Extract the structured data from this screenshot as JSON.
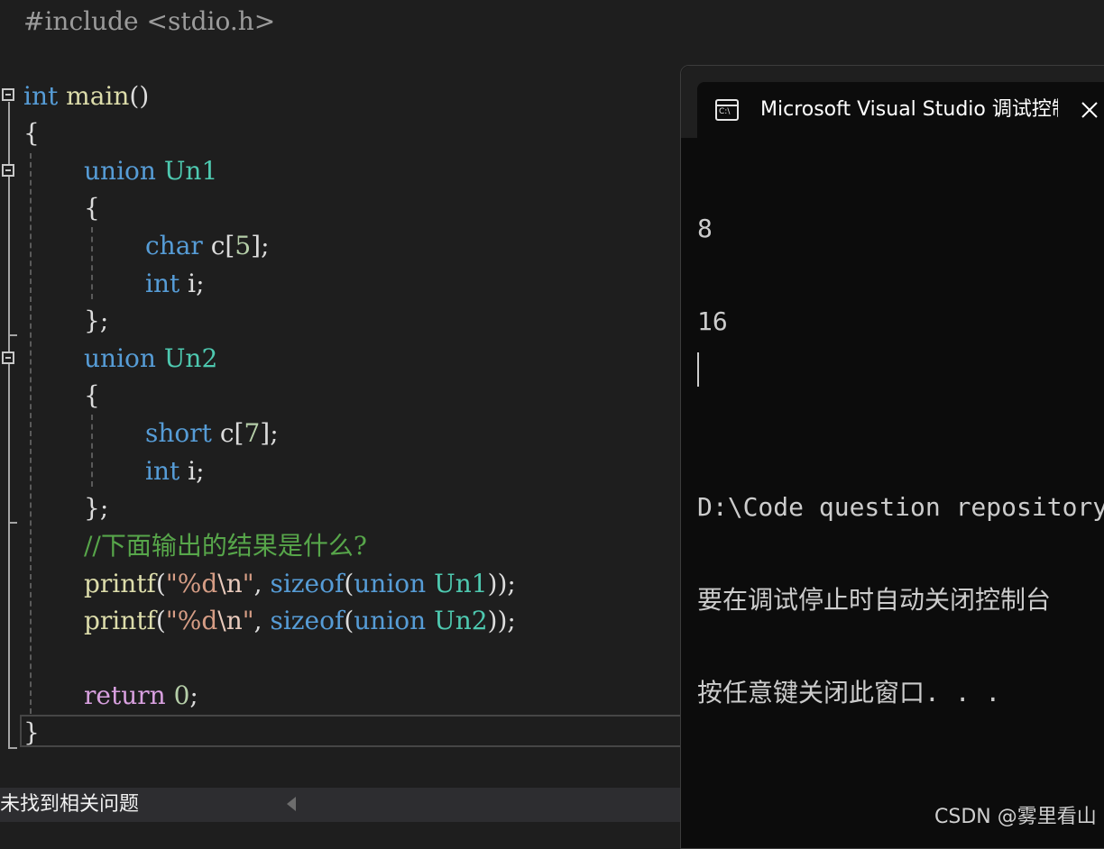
{
  "editor": {
    "include_line": "#include <stdio.h>",
    "tokens": {
      "int": "int",
      "main": "main",
      "parens": "()",
      "brace_open": "{",
      "brace_close": "}",
      "brace_close_semi": "};",
      "union": "union",
      "un1": "Un1",
      "un2": "Un2",
      "char": "char",
      "short": "short",
      "c": "c",
      "i": "i",
      "semi": ";",
      "lbr": "[",
      "rbr": "]",
      "five": "5",
      "seven": "7",
      "comment": "//下面输出的结果是什么?",
      "printf": "printf",
      "lparen": "(",
      "quote_open": "\"",
      "fmt": "%d",
      "escape": "\\n",
      "quote_close": "\"",
      "comma": ", ",
      "sizeof": "sizeof",
      "close_call": "));",
      "return": "return",
      "zero": "0"
    }
  },
  "status_bar": {
    "issues_text": "未找到相关问题"
  },
  "console": {
    "window_title": "Microsoft Visual Studio 调试控制台",
    "icon_text": "C:\\",
    "icon_name": "console-app-icon",
    "close_icon": "close-icon",
    "output_lines": [
      "8",
      "16",
      "",
      "D:\\Code question repository",
      "要在调试停止时自动关闭控制台",
      "按任意键关闭此窗口. . ."
    ]
  },
  "watermark": "CSDN @雾里看山"
}
